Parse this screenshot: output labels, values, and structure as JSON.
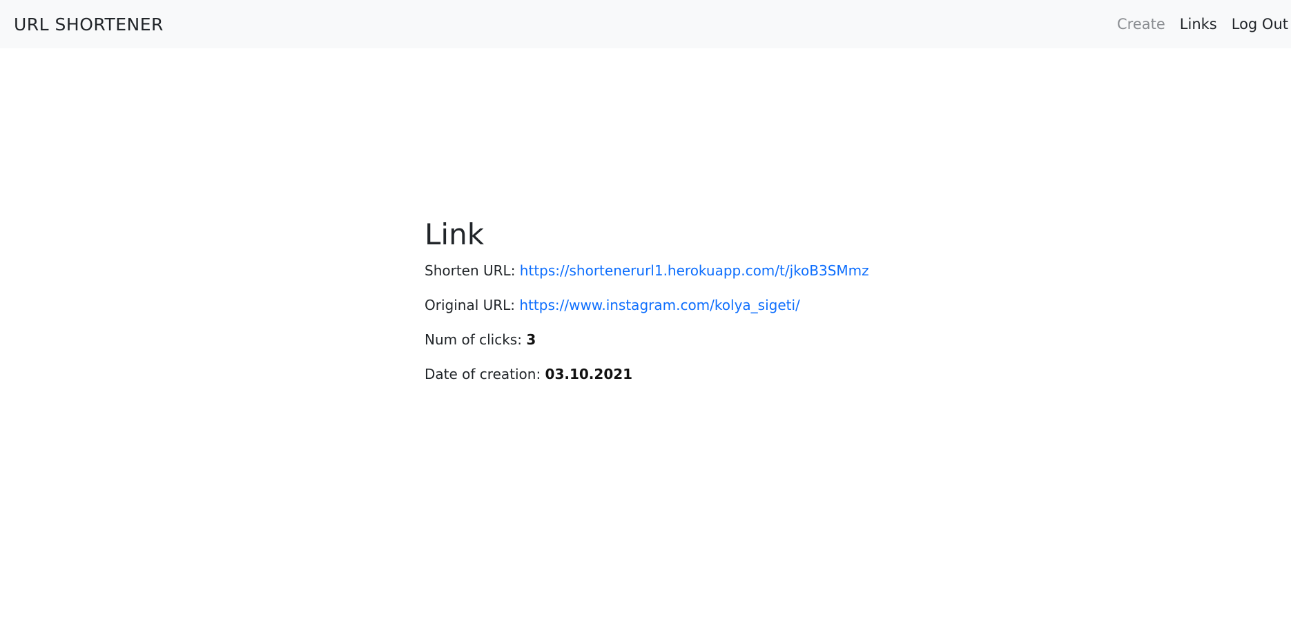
{
  "navbar": {
    "brand": "URL SHORTENER",
    "links": [
      {
        "label": "Create"
      },
      {
        "label": "Links"
      },
      {
        "label": "Log Out"
      }
    ]
  },
  "detail": {
    "title": "Link",
    "shorten_label": "Shorten URL: ",
    "shorten_url": "https://shortenerurl1.herokuapp.com/t/jkoB3SMmz",
    "original_label": "Original URL: ",
    "original_url": "https://www.instagram.com/kolya_sigeti/",
    "clicks_label": "Num of clicks: ",
    "clicks_value": "3",
    "date_label": "Date of creation: ",
    "date_value": "03.10.2021"
  },
  "colors": {
    "navbar_bg": "#f8f9fa",
    "link": "#0d6efd",
    "muted_nav": "#8a8d91",
    "text": "#212529"
  }
}
